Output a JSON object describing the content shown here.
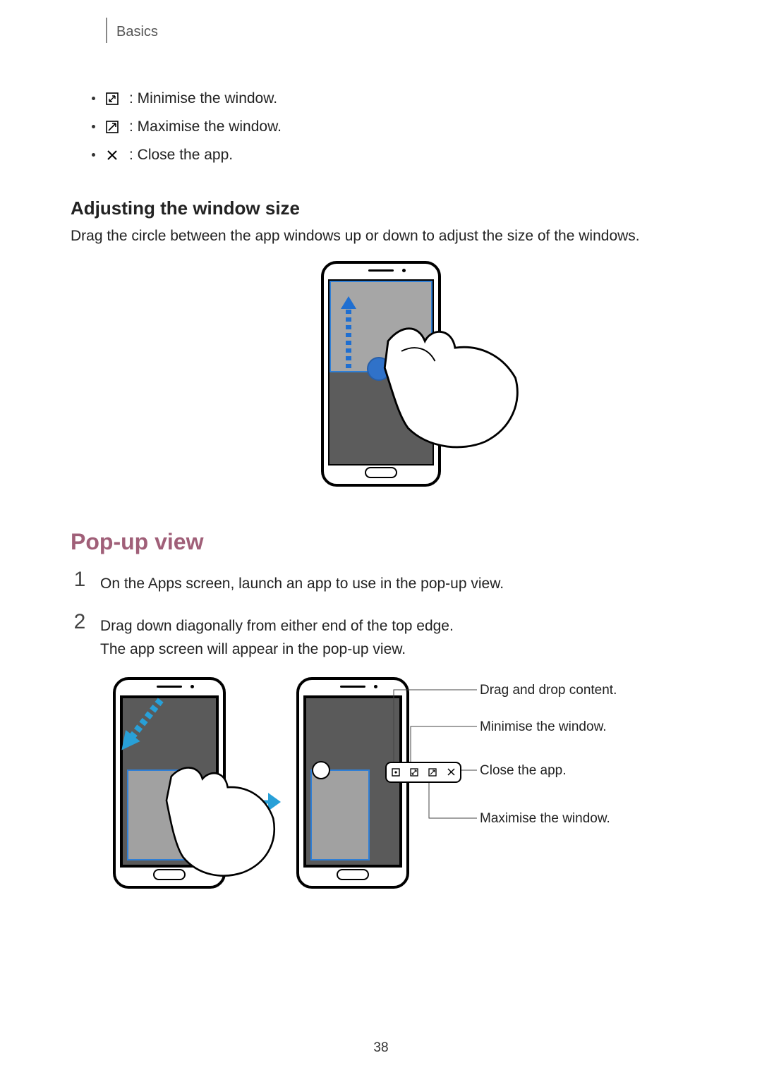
{
  "header": {
    "section": "Basics"
  },
  "iconList": {
    "minimise": ": Minimise the window.",
    "maximise": ": Maximise the window.",
    "close": ": Close the app."
  },
  "adjust": {
    "heading": "Adjusting the window size",
    "body": "Drag the circle between the app windows up or down to adjust the size of the windows."
  },
  "popup": {
    "heading": "Pop-up view",
    "step1_num": "1",
    "step1": "On the Apps screen, launch an app to use in the pop-up view.",
    "step2_num": "2",
    "step2a": "Drag down diagonally from either end of the top edge.",
    "step2b": "The app screen will appear in the pop-up view."
  },
  "callouts": {
    "drag": "Drag and drop content.",
    "min": "Minimise the window.",
    "close": "Close the app.",
    "max": "Maximise the window."
  },
  "pageNumber": "38"
}
